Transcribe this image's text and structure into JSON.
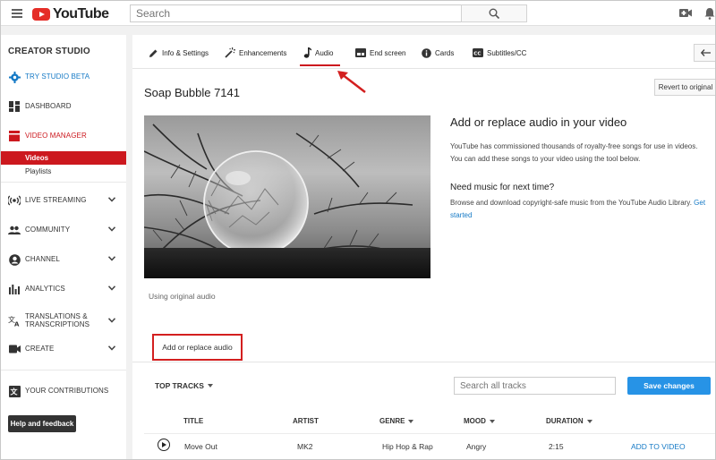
{
  "header": {
    "logo_text": "YouTube",
    "search_placeholder": "Search"
  },
  "sidebar": {
    "title": "CREATOR STUDIO",
    "items": [
      {
        "label": "TRY STUDIO BETA"
      },
      {
        "label": "DASHBOARD"
      },
      {
        "label": "VIDEO MANAGER"
      },
      {
        "label": "LIVE STREAMING"
      },
      {
        "label": "COMMUNITY"
      },
      {
        "label": "CHANNEL"
      },
      {
        "label": "ANALYTICS"
      },
      {
        "label": "TRANSLATIONS &",
        "label2": "TRANSCRIPTIONS"
      },
      {
        "label": "CREATE"
      },
      {
        "label": "YOUR CONTRIBUTIONS"
      }
    ],
    "subitems": [
      "Videos",
      "Playlists"
    ],
    "help_label": "Help and feedback"
  },
  "tabs": [
    "Info & Settings",
    "Enhancements",
    "Audio",
    "End screen",
    "Cards",
    "Subtitles/CC"
  ],
  "video": {
    "title": "Soap Bubble 7141",
    "revert_label": "Revert to original",
    "audio_status": "Using original audio"
  },
  "info": {
    "heading": "Add or replace audio in your video",
    "paragraph": "YouTube has commissioned thousands of royalty-free songs for use in videos. You can add these songs to your video using the tool below.",
    "heading2": "Need music for next time?",
    "paragraph2": "Browse and download copyright-safe music from the YouTube Audio Library.",
    "link": "Get started"
  },
  "audio_tab_label": "Add or replace audio",
  "tracks": {
    "filter_label": "TOP TRACKS",
    "search_placeholder": "Search all tracks",
    "save_label": "Save changes",
    "columns": [
      "TITLE",
      "ARTIST",
      "GENRE",
      "MOOD",
      "DURATION"
    ],
    "rows": [
      {
        "title": "Move Out",
        "artist": "MK2",
        "genre": "Hip Hop & Rap",
        "mood": "Angry",
        "duration": "2:15",
        "action": "ADD TO VIDEO"
      }
    ]
  },
  "colors": {
    "brand_red": "#cc181e",
    "link_blue": "#167ac6",
    "save_blue": "#2793e6",
    "annotation_red": "#d31f1f"
  }
}
